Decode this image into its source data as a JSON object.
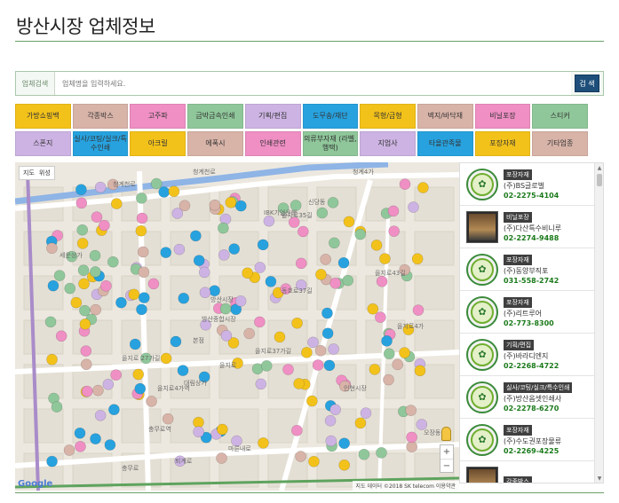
{
  "page": {
    "title": "방산시장 업체정보"
  },
  "search": {
    "label": "업체검색",
    "placeholder": "업체명을 입력하세요.",
    "button": "검 색"
  },
  "categories": [
    {
      "label": "가방쇼핑백",
      "color": "#f3c21a"
    },
    {
      "label": "각종박스",
      "color": "#d8b3a8"
    },
    {
      "label": "고주파",
      "color": "#ef8fc4"
    },
    {
      "label": "금박금속인쇄",
      "color": "#8fc79a"
    },
    {
      "label": "기획/편집",
      "color": "#cdb3e3"
    },
    {
      "label": "도무송/재단",
      "color": "#27a2df"
    },
    {
      "label": "목형/금형",
      "color": "#f3c21a"
    },
    {
      "label": "벽지/바닥재",
      "color": "#d8b3a8"
    },
    {
      "label": "비닐포장",
      "color": "#ef8fc4"
    },
    {
      "label": "스티커",
      "color": "#8fc79a"
    },
    {
      "label": "스폰지",
      "color": "#cdb3e3"
    },
    {
      "label": "실사/코팅/실크/특수인쇄",
      "color": "#27a2df"
    },
    {
      "label": "아크릴",
      "color": "#f3c21a"
    },
    {
      "label": "에폭시",
      "color": "#d8b3a8"
    },
    {
      "label": "인쇄관련",
      "color": "#ef8fc4"
    },
    {
      "label": "의류부자재 (라벨,행택)",
      "color": "#8fc79a"
    },
    {
      "label": "지업사",
      "color": "#cdb3e3"
    },
    {
      "label": "타올관족물",
      "color": "#27a2df"
    },
    {
      "label": "포장자재",
      "color": "#f3c21a"
    },
    {
      "label": "기타업종",
      "color": "#d8b3a8"
    }
  ],
  "map": {
    "type_options": [
      "지도",
      "위성"
    ],
    "labels": [
      "청계천로",
      "청계천로",
      "을지로35길",
      "동호로37길",
      "을지로37가길",
      "을지로",
      "퇴계로",
      "마른내로",
      "IBK기업은행",
      "방산시장",
      "을지로4가역",
      "충무로역",
      "대림상가",
      "세운상가",
      "방산종합시장",
      "신당동",
      "을지로43길",
      "충무로",
      "인현시장",
      "을지로4가",
      "오장동",
      "본점",
      "을지로 27가길",
      "청계4가"
    ],
    "zoom_in": "+",
    "zoom_out": "−",
    "logo": "Google",
    "attribution": "지도 데이터 ©2018 SK telecom  이용약관"
  },
  "companies": [
    {
      "tag": "포장자재",
      "name": "(주)BS글로벌",
      "phone": "02-2275-4104",
      "icon": "logo"
    },
    {
      "tag": "비닐포장",
      "name": "(주)다산특수비니루",
      "phone": "02-2274-9488",
      "icon": "photo"
    },
    {
      "tag": "포장자재",
      "name": "(주)동양부직포",
      "phone": "031-558-2742",
      "icon": "logo"
    },
    {
      "tag": "포장자재",
      "name": "(주)리트루어",
      "phone": "02-773-8300",
      "icon": "logo"
    },
    {
      "tag": "기획/편집",
      "name": "(주)바라디엔지",
      "phone": "02-2268-4722",
      "icon": "logo"
    },
    {
      "tag": "실사/코팅/실크/특수인쇄",
      "name": "(주)방산옵셋인쇄사",
      "phone": "02-2278-6270",
      "icon": "logo"
    },
    {
      "tag": "포장자재",
      "name": "(주)수도권포장물류",
      "phone": "02-2269-4225",
      "icon": "logo"
    },
    {
      "tag": "각종박스",
      "name": "",
      "phone": "",
      "icon": "photo"
    }
  ],
  "colors": {
    "pin_palette": [
      "#f3c21a",
      "#ef8fc4",
      "#8fc79a",
      "#27a2df",
      "#cdb3e3",
      "#d8b3a8"
    ]
  }
}
